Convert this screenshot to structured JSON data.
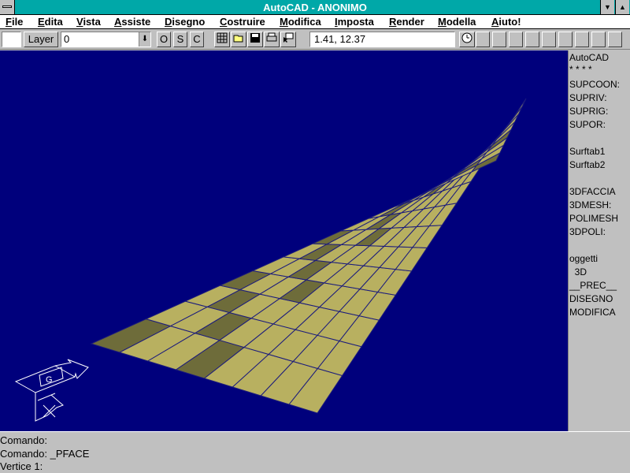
{
  "window": {
    "title": "AutoCAD - ANONIMO",
    "system_menu_icon": "dash-icon",
    "minimize_icon": "triangle-down-icon",
    "maximize_icon": "triangle-up-icon"
  },
  "menubar": {
    "items": [
      "File",
      "Edita",
      "Vista",
      "Assiste",
      "Disegno",
      "Costruire",
      "Modifica",
      "Imposta",
      "Render",
      "Modella",
      "Aiuto!"
    ]
  },
  "toolbar": {
    "layer_label": "Layer",
    "layer_value": "0",
    "osnap_label": "O",
    "snap_label": "S",
    "copy_label": "C",
    "coordinates": "1.41, 12.37",
    "icons": [
      "grid-icon",
      "open-folder-icon",
      "save-disk-icon",
      "print-icon",
      "pointer-icon",
      "clock-icon"
    ]
  },
  "screen_menu": {
    "items": [
      "AutoCAD",
      "* * * *",
      "SUPCOON:",
      "SUPRIV:",
      "SUPRIG:",
      "SUPOR:",
      "",
      "Surftab1",
      "Surftab2",
      "",
      "3DFACCIA",
      "3DMESH:",
      "POLIMESH",
      "3DPOLI:",
      "",
      "oggetti",
      "  3D",
      "__PREC__",
      "DISEGNO",
      "MODIFICA"
    ]
  },
  "command": {
    "lines": [
      "Comando:",
      "Comando: _PFACE",
      "Vertice 1:"
    ]
  },
  "ucs_icon": {
    "label": "G"
  },
  "colors": {
    "titlebar": "#00a8a8",
    "drawing_bg": "#00007c",
    "mesh_fill_light": "#b8b060",
    "mesh_fill_dark": "#6e6c3a",
    "mesh_line": "#1c1c7c"
  }
}
